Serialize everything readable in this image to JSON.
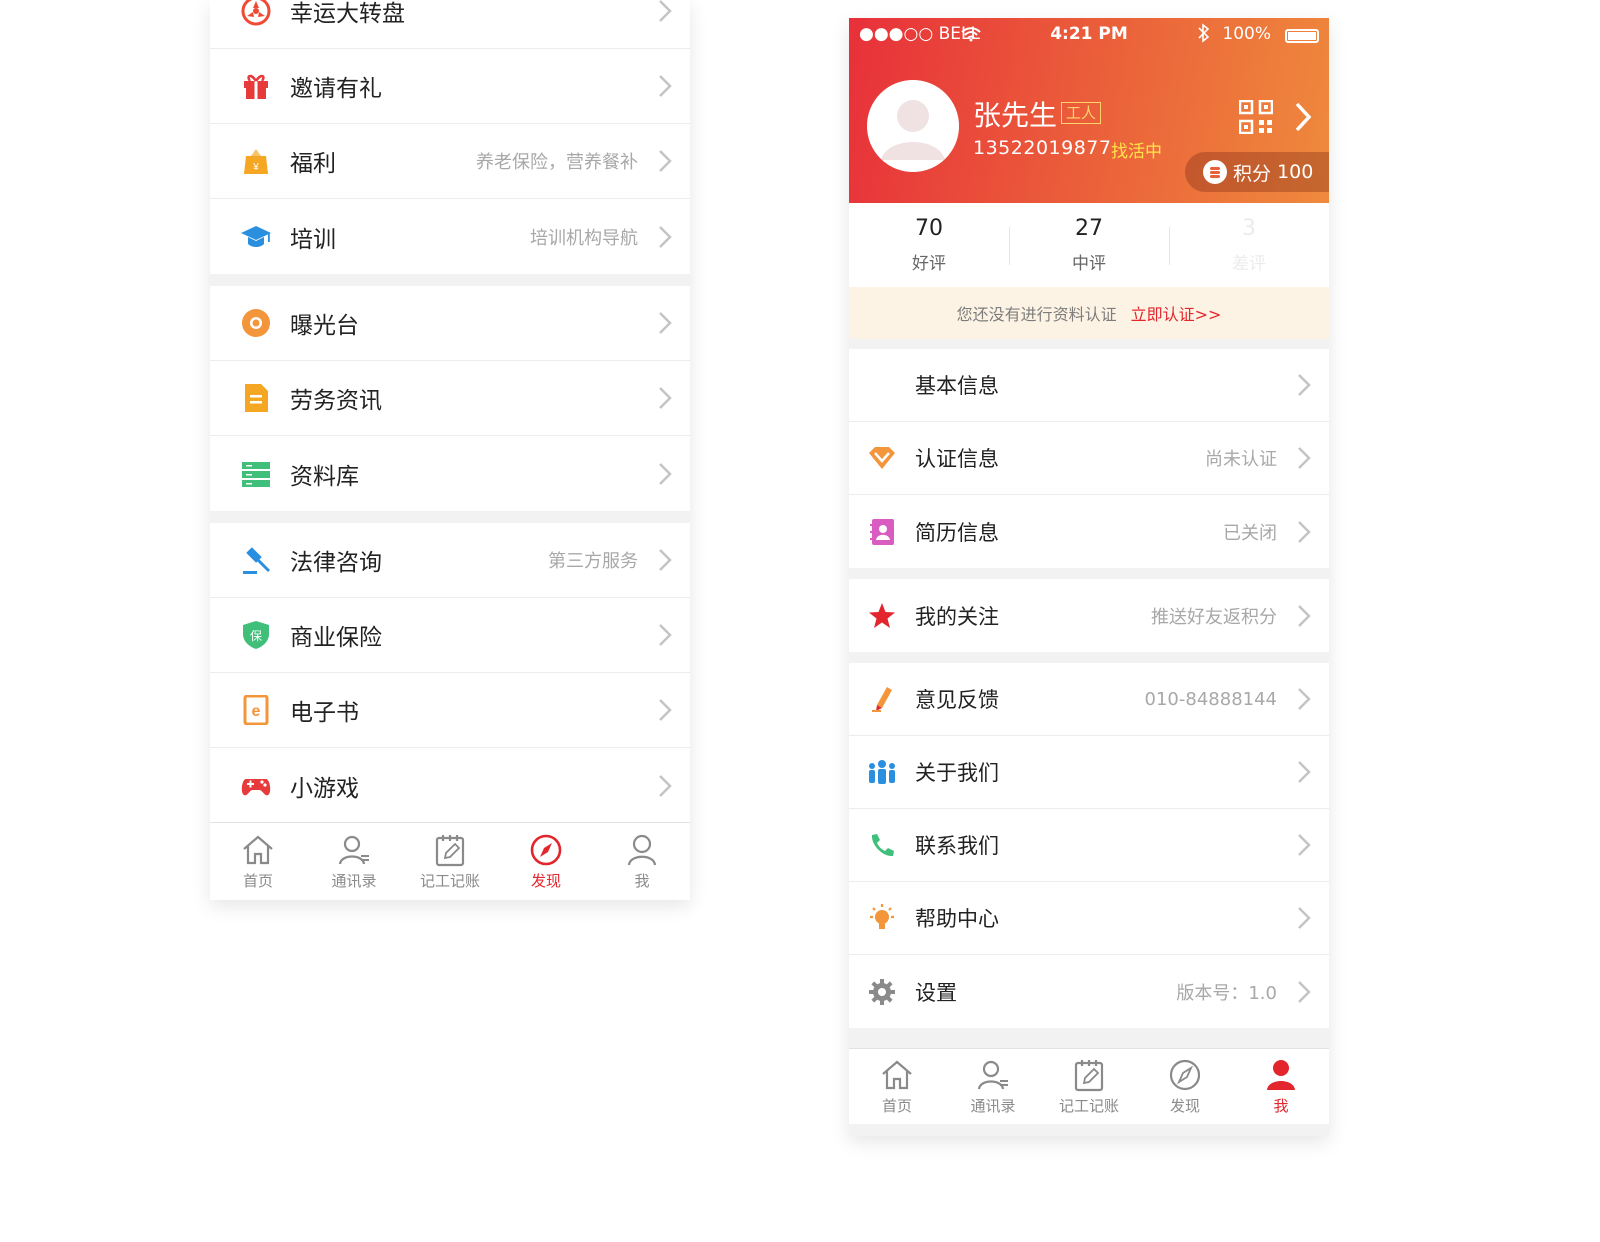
{
  "left": {
    "menu_group1": [
      {
        "label": "幸运大转盘",
        "sub": "",
        "icon": "wheel-icon"
      },
      {
        "label": "邀请有礼",
        "sub": "",
        "icon": "gift-icon"
      },
      {
        "label": "福利",
        "sub": "养老保险，营养餐补",
        "icon": "welfare-bag-icon"
      },
      {
        "label": "培训",
        "sub": "培训机构导航",
        "icon": "graduation-cap-icon"
      }
    ],
    "menu_group2": [
      {
        "label": "曝光台",
        "sub": "",
        "icon": "sun-icon"
      },
      {
        "label": "劳务资讯",
        "sub": "",
        "icon": "document-icon"
      },
      {
        "label": "资料库",
        "sub": "",
        "icon": "database-icon"
      }
    ],
    "menu_group3": [
      {
        "label": "法律咨询",
        "sub": "第三方服务",
        "icon": "gavel-icon"
      },
      {
        "label": "商业保险",
        "sub": "",
        "icon": "shield-icon"
      },
      {
        "label": "电子书",
        "sub": "",
        "icon": "ebook-icon"
      },
      {
        "label": "小游戏",
        "sub": "",
        "icon": "gamepad-icon"
      }
    ],
    "tabs": [
      {
        "label": "首页",
        "icon": "home-icon"
      },
      {
        "label": "通讯录",
        "icon": "contacts-icon"
      },
      {
        "label": "记工记账",
        "icon": "notebook-icon"
      },
      {
        "label": "发现",
        "icon": "compass-icon"
      },
      {
        "label": "我",
        "icon": "person-icon"
      }
    ],
    "active_tab": "发现"
  },
  "right": {
    "status_bar": {
      "carrier": "●●●○○ BELL",
      "time": "4:21 PM",
      "battery": "100%"
    },
    "profile": {
      "name": "张先生",
      "role": "工人",
      "phone": "13522019877",
      "job_status": "找活中",
      "points_label": "积分",
      "points_value": "100"
    },
    "reviews": [
      {
        "count": "70",
        "label": "好评"
      },
      {
        "count": "27",
        "label": "中评"
      },
      {
        "count": "3",
        "label": "差评"
      }
    ],
    "cert_banner": {
      "text": "您还没有进行资料认证",
      "link": "立即认证>>"
    },
    "group1": [
      {
        "label": "基本信息",
        "sub": "",
        "icon": ""
      },
      {
        "label": "认证信息",
        "sub": "尚未认证",
        "icon": "diamond-icon"
      },
      {
        "label": "简历信息",
        "sub": "已关闭",
        "icon": "resume-icon"
      }
    ],
    "group2": [
      {
        "label": "我的关注",
        "sub": "推送好友返积分",
        "icon": "star-icon"
      }
    ],
    "group3": [
      {
        "label": "意见反馈",
        "sub": "010-84888144",
        "icon": "pencil-icon"
      },
      {
        "label": "关于我们",
        "sub": "",
        "icon": "team-icon"
      },
      {
        "label": "联系我们",
        "sub": "",
        "icon": "phone-icon"
      },
      {
        "label": "帮助中心",
        "sub": "",
        "icon": "bulb-icon"
      },
      {
        "label": "设置",
        "sub": "版本号：1.0",
        "icon": "gear-icon"
      }
    ],
    "tabs": [
      {
        "label": "首页",
        "icon": "home-icon"
      },
      {
        "label": "通讯录",
        "icon": "contacts-icon"
      },
      {
        "label": "记工记账",
        "icon": "notebook-icon"
      },
      {
        "label": "发现",
        "icon": "compass-icon"
      },
      {
        "label": "我",
        "icon": "person-icon"
      }
    ],
    "active_tab": "我"
  },
  "colors": {
    "accent": "#e3262d",
    "header_start": "#e8303a",
    "header_end": "#ef8a3c",
    "banner_bg": "#fdf3e4"
  }
}
